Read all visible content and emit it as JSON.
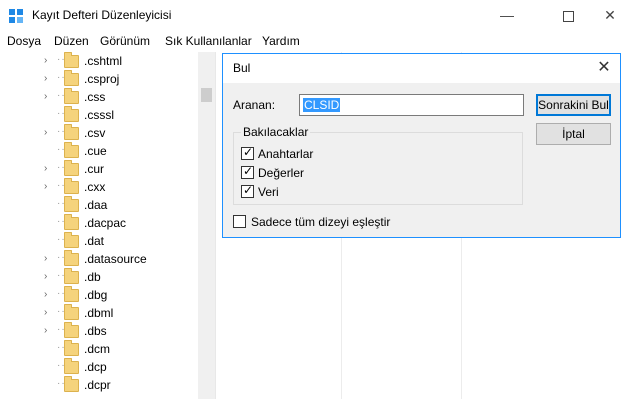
{
  "window": {
    "title": "Kayıt Defteri Düzenleyicisi",
    "minimize": "—",
    "close": "✕"
  },
  "menu": [
    "Dosya",
    "Düzen",
    "Görünüm",
    "Sık Kullanılanlar",
    "Yardım"
  ],
  "tree": {
    "items": [
      {
        "label": ".cshtml",
        "expandable": true
      },
      {
        "label": ".csproj",
        "expandable": true
      },
      {
        "label": ".css",
        "expandable": true
      },
      {
        "label": ".csssl",
        "expandable": false
      },
      {
        "label": ".csv",
        "expandable": true
      },
      {
        "label": ".cue",
        "expandable": false
      },
      {
        "label": ".cur",
        "expandable": true
      },
      {
        "label": ".cxx",
        "expandable": true
      },
      {
        "label": ".daa",
        "expandable": false
      },
      {
        "label": ".dacpac",
        "expandable": false
      },
      {
        "label": ".dat",
        "expandable": false
      },
      {
        "label": ".datasource",
        "expandable": true
      },
      {
        "label": ".db",
        "expandable": true
      },
      {
        "label": ".dbg",
        "expandable": true
      },
      {
        "label": ".dbml",
        "expandable": true
      },
      {
        "label": ".dbs",
        "expandable": true
      },
      {
        "label": ".dcm",
        "expandable": false
      },
      {
        "label": ".dcp",
        "expandable": false
      },
      {
        "label": ".dcpr",
        "expandable": false
      }
    ]
  },
  "dialog": {
    "title": "Bul",
    "close": "✕",
    "search_label": "Aranan:",
    "search_value": "CLSID",
    "next_button": "Sonrakini Bul",
    "cancel_button": "İptal",
    "group_title": "Bakılacaklar",
    "options": [
      {
        "label": "Anahtarlar",
        "checked": true
      },
      {
        "label": "Değerler",
        "checked": true
      },
      {
        "label": "Veri",
        "checked": true
      }
    ],
    "whole_match": {
      "label": "Sadece tüm dizeyi eşleştir",
      "checked": false
    }
  }
}
